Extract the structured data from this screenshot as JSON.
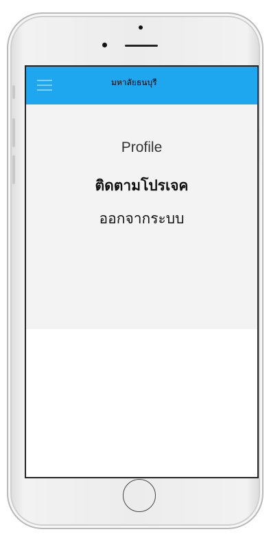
{
  "app": {
    "title": "มหาลัยธนบุรี"
  },
  "header": {
    "menu_icon": "hamburger-menu-icon",
    "background_color": "#1ea6ef"
  },
  "menu": {
    "items": [
      {
        "label": "Profile"
      },
      {
        "label": "ติดตามโปรเจค"
      },
      {
        "label": "ออกจากระบบ"
      }
    ]
  },
  "device": {
    "frame": "phone-frame",
    "home_button_icon": "home-button-icon"
  }
}
